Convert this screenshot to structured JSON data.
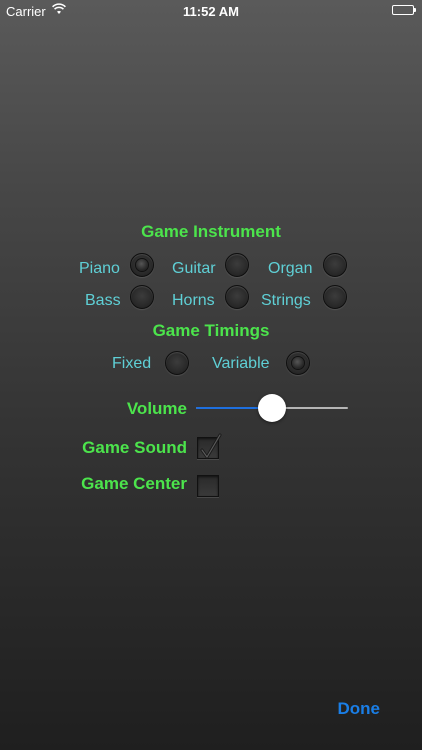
{
  "status_bar": {
    "carrier": "Carrier",
    "time": "11:52 AM",
    "wifi_icon": "wifi-icon",
    "battery_icon": "battery-icon",
    "battery_level": 1.0
  },
  "instrument": {
    "title": "Game Instrument",
    "options": [
      {
        "label": "Piano",
        "selected": true
      },
      {
        "label": "Guitar",
        "selected": false
      },
      {
        "label": "Organ",
        "selected": false
      },
      {
        "label": "Bass",
        "selected": false
      },
      {
        "label": "Horns",
        "selected": false
      },
      {
        "label": "Strings",
        "selected": false
      }
    ]
  },
  "timings": {
    "title": "Game Timings",
    "options": [
      {
        "label": "Fixed",
        "selected": false
      },
      {
        "label": "Variable",
        "selected": true
      }
    ]
  },
  "volume": {
    "label": "Volume",
    "value": 0.5
  },
  "game_sound": {
    "label": "Game Sound",
    "checked": true
  },
  "game_center": {
    "label": "Game Center",
    "checked": false
  },
  "done_label": "Done",
  "colors": {
    "section_title": "#4ce44c",
    "option_label": "#5fd0d6",
    "done_button": "#1a7ee6",
    "slider_fill": "#1e6fde"
  }
}
